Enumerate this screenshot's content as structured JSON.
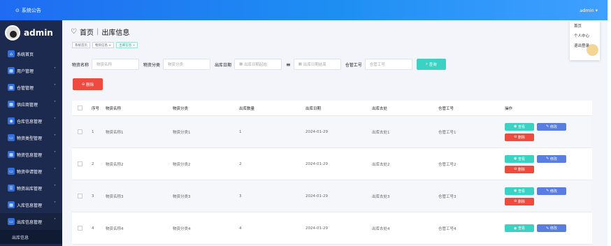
{
  "topbar": {
    "notice": "系统公告",
    "user": "admin ▾"
  },
  "sidebar": {
    "username": "admin",
    "items": [
      {
        "label": "系统首页",
        "icon": "home-icon"
      },
      {
        "label": "用户管理",
        "icon": "user-icon",
        "chevron": "˅"
      },
      {
        "label": "仓管管理",
        "icon": "warehouse-icon",
        "chevron": "˅"
      },
      {
        "label": "供应商管理",
        "icon": "supplier-icon",
        "chevron": "˅"
      },
      {
        "label": "仓库信息管理",
        "icon": "store-icon",
        "chevron": "˅"
      },
      {
        "label": "物资类型管理",
        "icon": "type-icon",
        "chevron": "˅"
      },
      {
        "label": "物资信息管理",
        "icon": "goods-icon",
        "chevron": "˅"
      },
      {
        "label": "物资申请管理",
        "icon": "apply-icon",
        "chevron": "˅"
      },
      {
        "label": "物资出库管理",
        "icon": "out-icon",
        "chevron": "˅"
      },
      {
        "label": "入库信息管理",
        "icon": "in-icon",
        "chevron": "˅"
      },
      {
        "label": "出库信息管理",
        "icon": "outbound-icon",
        "chevron": "˄"
      }
    ],
    "sub_item": "出库信息"
  },
  "page": {
    "home": "首页",
    "separator": "|",
    "title": "出库信息"
  },
  "tags": [
    "系统首页",
    "物资信息 ×",
    "出库信息 ×"
  ],
  "filter": {
    "name_label": "物资名称",
    "name_placeholder": "物资名称",
    "cls_label": "物资分类",
    "cls_placeholder": "物资分类",
    "date_label": "出库日期",
    "date_start": "出库日期起始",
    "date_end": "出库日期结束",
    "wid_label": "仓管工号",
    "wid_placeholder": "仓管工号",
    "search": "查询"
  },
  "delete_label": "删除",
  "table": {
    "headers": [
      "序号",
      "物资名称",
      "物资分类",
      "出库数量",
      "出库日期",
      "出库去处",
      "仓管工号",
      "操作"
    ],
    "rows": [
      {
        "no": "1",
        "name": "物资名称1",
        "cls": "物资分类1",
        "qty": "1",
        "date": "2024-01-29",
        "place": "出库去处1",
        "wid": "仓管工号1"
      },
      {
        "no": "2",
        "name": "物资名称2",
        "cls": "物资分类2",
        "qty": "2",
        "date": "2024-01-29",
        "place": "出库去处2",
        "wid": "仓管工号2"
      },
      {
        "no": "3",
        "name": "物资名称3",
        "cls": "物资分类3",
        "qty": "3",
        "date": "2024-01-29",
        "place": "出库去处3",
        "wid": "仓管工号3"
      },
      {
        "no": "4",
        "name": "物资名称4",
        "cls": "物资分类4",
        "qty": "4",
        "date": "2024-01-29",
        "place": "出库去处4",
        "wid": "仓管工号4"
      }
    ],
    "view": "查看",
    "edit": "修改",
    "remove": "删除"
  },
  "dropdown": [
    "首页",
    "个人中心",
    "退出登录"
  ],
  "colors": {
    "primary": "#1e8ef3",
    "teal": "#3bd1c3",
    "danger": "#ef4a3d",
    "sidebar": "#1d2a4f"
  }
}
